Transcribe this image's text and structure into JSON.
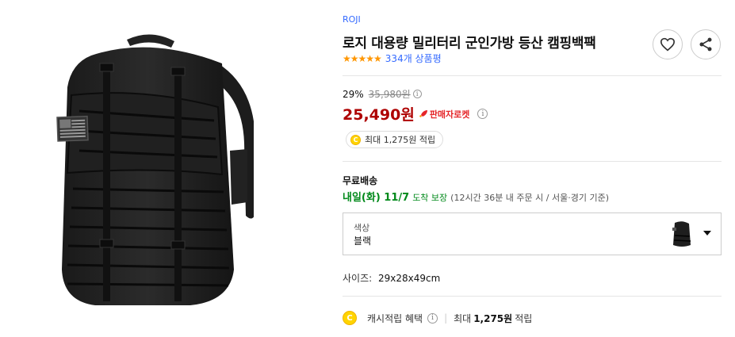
{
  "product": {
    "brand": "ROJI",
    "title": "로지 대용량 밀리터리 군인가방 등산 캠핑백팩",
    "rating_stars": "★★★★★",
    "review_count": "334개 상품평"
  },
  "actions": {
    "wishlist_icon": "heart-icon",
    "share_icon": "share-icon"
  },
  "price": {
    "discount_rate": "29%",
    "original_price": "35,980원",
    "sale_price": "25,490원",
    "seller_rocket": "판매자로켓",
    "info_glyph": "i"
  },
  "reward": {
    "coin_glyph": "C",
    "text": "최대 1,275원 적립"
  },
  "shipping": {
    "label": "무료배송",
    "arrival": "내일(화) 11/7",
    "guarantee": "도착 보장",
    "note": "(12시간 36분  내 주문 시 / 서울·경기 기준)"
  },
  "option": {
    "label": "색상",
    "value": "블랙"
  },
  "size": {
    "label": "사이즈:",
    "value": "29x28x49cm"
  },
  "cash": {
    "label": "캐시적립 혜택",
    "separator": "|",
    "max_label": "최대",
    "amount": "1,275원",
    "suffix": "적립"
  },
  "colors": {
    "accent_blue": "#346aff",
    "price_red": "#ae0000",
    "rocket_red": "#e52528",
    "delivery_green": "#00891a",
    "star_orange": "#ff9600"
  }
}
